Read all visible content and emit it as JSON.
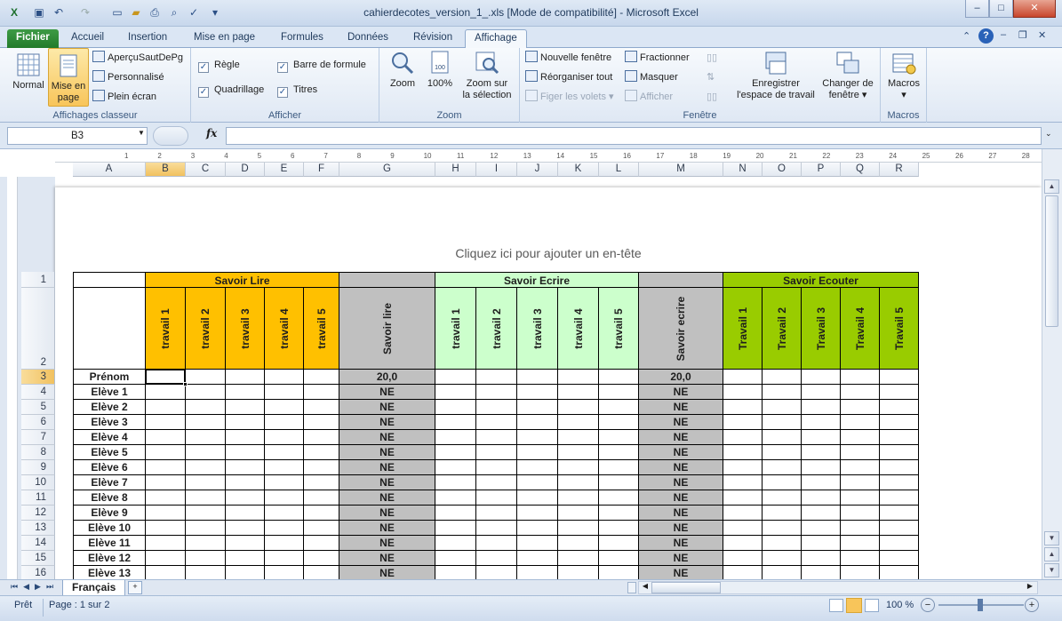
{
  "window": {
    "title": "cahierdecotes_version_1_.xls  [Mode de compatibilité]  -  Microsoft Excel"
  },
  "tabs": [
    {
      "label": "Fichier"
    },
    {
      "label": "Accueil"
    },
    {
      "label": "Insertion"
    },
    {
      "label": "Mise en page"
    },
    {
      "label": "Formules"
    },
    {
      "label": "Données"
    },
    {
      "label": "Révision"
    },
    {
      "label": "Affichage"
    }
  ],
  "ribbon": {
    "views": {
      "normal": "Normal",
      "page_layout": "Mise en page",
      "page_break": "AperçuSautDePg",
      "custom": "Personnalisé",
      "fullscreen": "Plein écran",
      "label": "Affichages classeur"
    },
    "show": {
      "ruler": "Règle",
      "gridlines": "Quadrillage",
      "formula_bar": "Barre de formule",
      "headings": "Titres",
      "label": "Afficher"
    },
    "zoom": {
      "zoom": "Zoom",
      "hundred": "100%",
      "to_selection_1": "Zoom sur",
      "to_selection_2": "la sélection",
      "label": "Zoom"
    },
    "window": {
      "new_window": "Nouvelle fenêtre",
      "arrange_all": "Réorganiser tout",
      "freeze": "Figer les volets",
      "split": "Fractionner",
      "hide": "Masquer",
      "unhide": "Afficher",
      "save_ws_1": "Enregistrer",
      "save_ws_2": "l'espace de travail",
      "switch_1": "Changer de",
      "switch_2": "fenêtre",
      "label": "Fenêtre"
    },
    "macros": {
      "macros": "Macros",
      "label": "Macros"
    }
  },
  "formula": {
    "namebox": "B3",
    "fx": "fx",
    "value": ""
  },
  "columns": [
    "A",
    "B",
    "C",
    "D",
    "E",
    "F",
    "G",
    "H",
    "I",
    "J",
    "K",
    "L",
    "M",
    "N",
    "O",
    "P",
    "Q",
    "R"
  ],
  "ruler_marks": [
    "1",
    "2",
    "3",
    "4",
    "5",
    "6",
    "7",
    "8",
    "9",
    "10",
    "11",
    "12",
    "13",
    "14",
    "15",
    "16",
    "17",
    "18",
    "19",
    "20",
    "21",
    "22",
    "23",
    "24",
    "25",
    "26",
    "27",
    "28"
  ],
  "header_hint": "Cliquez ici pour ajouter un en-tête",
  "sheet": {
    "groups": {
      "lire": "Savoir Lire",
      "ecrire": "Savoir Ecrire",
      "ecouter": "Savoir Ecouter"
    },
    "lire_cols": [
      "travail 1",
      "travail 2",
      "travail 3",
      "travail 4",
      "travail 5"
    ],
    "lire_total": "Savoir lire",
    "ecrire_cols": [
      "travail 1",
      "travail 2",
      "travail 3",
      "travail 4",
      "travail 5"
    ],
    "ecrire_total": "Savoir ecrire",
    "ecouter_cols": [
      "Travail 1",
      "Travail 2",
      "Travail 3",
      "Travail 4",
      "Travail 5"
    ],
    "row_header_label": "Prénom",
    "max_score_lire": "20,0",
    "max_score_ecrire": "20,0",
    "students": [
      "Elève 1",
      "Elève 2",
      "Elève 3",
      "Elève 4",
      "Elève 5",
      "Elève 6",
      "Elève 7",
      "Elève 8",
      "Elève 9",
      "Elève 10",
      "Elève 11",
      "Elève 12",
      "Elève 13"
    ],
    "ne_value": "NE",
    "row_numbers": [
      "1",
      "2",
      "3",
      "4",
      "5",
      "6",
      "7",
      "8",
      "9",
      "10",
      "11",
      "12",
      "13",
      "14",
      "15",
      "16"
    ]
  },
  "colors": {
    "lire": "#ffc000",
    "ecrire": "#ccffcc",
    "ecouter": "#99cc00",
    "total": "#c0c0c0"
  },
  "sheet_tab": "Français",
  "status": {
    "ready": "Prêt",
    "page": "Page : 1 sur 2",
    "zoom": "100 %"
  }
}
